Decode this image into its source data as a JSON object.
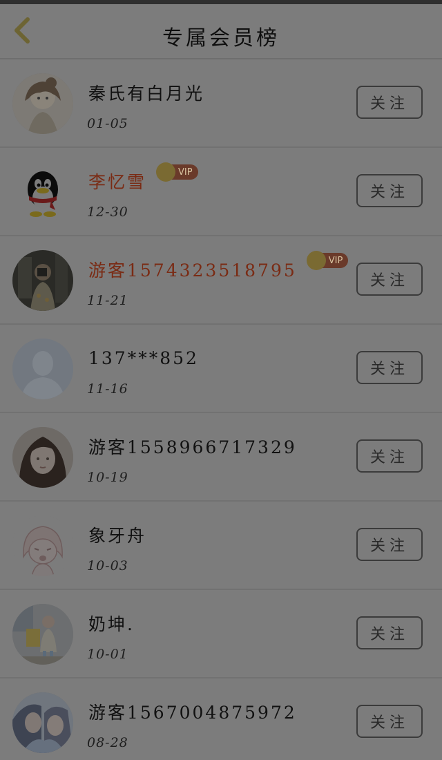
{
  "header": {
    "title": "专属会员榜"
  },
  "colors": {
    "overlay_bg": "#7c7c7c",
    "vip_name": "#7a2b14",
    "normal_name": "#111111"
  },
  "list": [
    {
      "name": "秦氏有白月光",
      "date": "01-05",
      "vip": false,
      "avatar_icon": "anime-girl-sketch-icon",
      "follow_label": "关注"
    },
    {
      "name": "李忆雪",
      "date": "12-30",
      "vip": true,
      "vip_label": "VIP",
      "avatar_icon": "penguin-avatar-icon",
      "follow_label": "关注"
    },
    {
      "name": "游客1574323518795",
      "date": "11-21",
      "vip": true,
      "vip_label": "VIP",
      "avatar_icon": "mirror-selfie-avatar-icon",
      "follow_label": "关注"
    },
    {
      "name": "137***852",
      "date": "11-16",
      "vip": false,
      "avatar_icon": "default-person-icon",
      "follow_label": "关注"
    },
    {
      "name": "游客1558966717329",
      "date": "10-19",
      "vip": false,
      "avatar_icon": "girl-portrait-avatar-icon",
      "follow_label": "关注"
    },
    {
      "name": "象牙舟",
      "date": "10-03",
      "vip": false,
      "avatar_icon": "anime-crying-girl-icon",
      "follow_label": "关注"
    },
    {
      "name": "奶坤.",
      "date": "10-01",
      "vip": false,
      "avatar_icon": "child-photo-avatar-icon",
      "follow_label": "关注"
    },
    {
      "name": "游客1567004875972",
      "date": "08-28",
      "vip": false,
      "avatar_icon": "anime-couple-avatar-icon",
      "follow_label": "关注"
    }
  ]
}
